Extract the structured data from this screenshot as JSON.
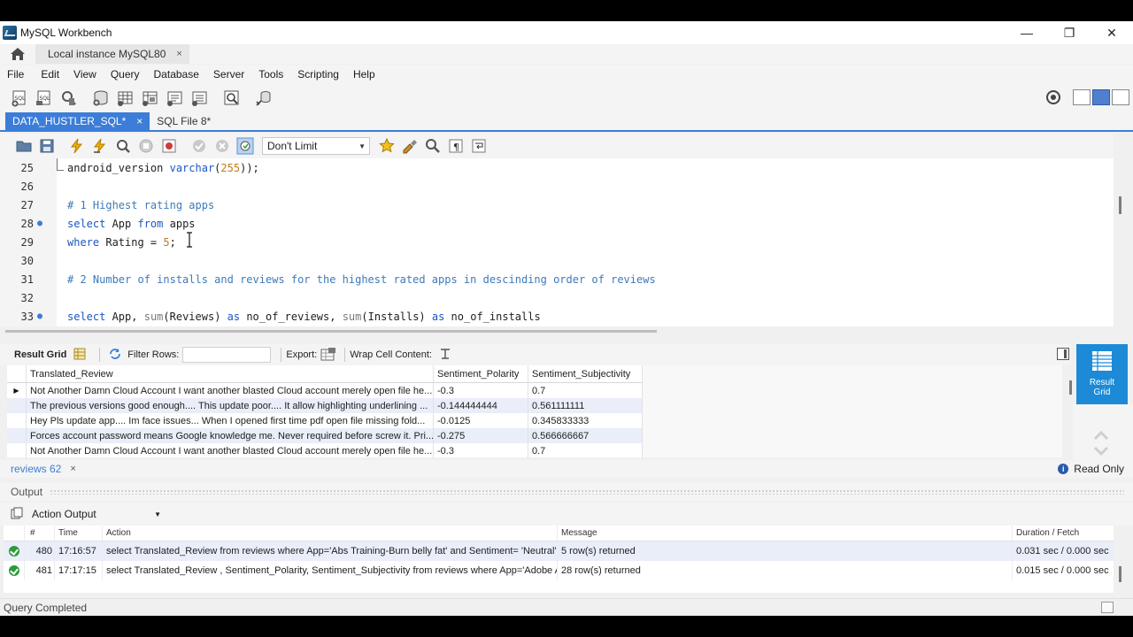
{
  "window": {
    "title": "MySQL Workbench",
    "minimize": "—",
    "maximize": "❐",
    "close": "✕"
  },
  "connection_tab": {
    "label": "Local instance MySQL80",
    "close": "×"
  },
  "menu": [
    "File",
    "Edit",
    "View",
    "Query",
    "Database",
    "Server",
    "Tools",
    "Scripting",
    "Help"
  ],
  "editor_tabs": [
    {
      "label": "DATA_HUSTLER_SQL*",
      "close": "×"
    },
    {
      "label": "SQL File 8*"
    }
  ],
  "sql_toolbar": {
    "limit": "Don't Limit"
  },
  "code_lines": [
    {
      "num": "25",
      "marker": ""
    },
    {
      "num": "26",
      "marker": ""
    },
    {
      "num": "27",
      "marker": ""
    },
    {
      "num": "28",
      "marker": "●"
    },
    {
      "num": "29",
      "marker": ""
    },
    {
      "num": "30",
      "marker": ""
    },
    {
      "num": "31",
      "marker": ""
    },
    {
      "num": "32",
      "marker": ""
    },
    {
      "num": "33",
      "marker": "●"
    }
  ],
  "code_tokens": {
    "l25": [
      "android_version ",
      "varchar",
      "(",
      "255",
      "));"
    ],
    "l27": "# 1 Highest rating apps",
    "l28": [
      "select",
      " App ",
      "from",
      " apps"
    ],
    "l29": [
      "where",
      " Rating = ",
      "5",
      ";"
    ],
    "l31": "# 2 Number of installs and reviews for the highest rated apps in descinding order of reviews",
    "l33": [
      "select",
      " App, ",
      "sum",
      "(Reviews) ",
      "as",
      " no_of_reviews, ",
      "sum",
      "(Installs) ",
      "as",
      " no_of_installs"
    ]
  },
  "result_toolbar": {
    "result_grid": "Result Grid",
    "filter_rows": "Filter Rows:",
    "export": "Export:",
    "wrap": "Wrap Cell Content:"
  },
  "grid": {
    "columns": [
      "Translated_Review",
      "Sentiment_Polarity",
      "Sentiment_Subjectivity"
    ],
    "row_marker": "▶",
    "rows": [
      [
        "Not Another Damn Cloud Account I want another blasted Cloud account merely open file he...",
        "-0.3",
        "0.7"
      ],
      [
        "The previous versions good enough.... This update poor.... It allow highlighting underlining ...",
        "-0.144444444",
        "0.561111111"
      ],
      [
        "Hey Pls update app.... Im face issues... When I opened first time pdf open file missing fold...",
        "-0.0125",
        "0.345833333"
      ],
      [
        "Forces account password means Google knowledge me. Never required before screw it. Pri...",
        "-0.275",
        "0.566666667"
      ],
      [
        "Not Another Damn Cloud Account I want another blasted Cloud account merely open file he...",
        "-0.3",
        "0.7"
      ]
    ]
  },
  "side_panel": {
    "result_grid_line1": "Result",
    "result_grid_line2": "Grid"
  },
  "result_tab": {
    "label": "reviews 62",
    "close": "×"
  },
  "read_only": "Read Only",
  "output": {
    "title": "Output",
    "select": "Action Output",
    "columns": [
      "",
      "#",
      "Time",
      "Action",
      "Message",
      "Duration / Fetch"
    ],
    "rows": [
      {
        "num": "480",
        "time": "17:16:57",
        "action": "select Translated_Review from reviews where App='Abs Training-Burn belly fat' and Sentiment= 'Neutral'",
        "message": "5 row(s) returned",
        "duration": "0.031 sec / 0.000 sec"
      },
      {
        "num": "481",
        "time": "17:17:15",
        "action": "select Translated_Review , Sentiment_Polarity, Sentiment_Subjectivity from reviews where App='Adobe A...",
        "message": "28 row(s) returned",
        "duration": "0.015 sec / 0.000 sec"
      }
    ]
  },
  "status": "Query Completed",
  "icons": {
    "home": "home-icon",
    "new_sql": "new-sql-tab-icon",
    "open_sql": "open-sql-script-icon",
    "execute": "execute-lightning-icon",
    "stop": "stop-icon",
    "save": "save-icon",
    "search": "magnifier-icon",
    "settings": "gear-icon"
  },
  "colors": {
    "accent": "#3b7dd8",
    "keyword": "#1a56c4",
    "comment": "#3d7ab9",
    "number": "#c07a1a",
    "success": "#2c9a3c",
    "result_grid_btn": "#1c8ad6"
  }
}
